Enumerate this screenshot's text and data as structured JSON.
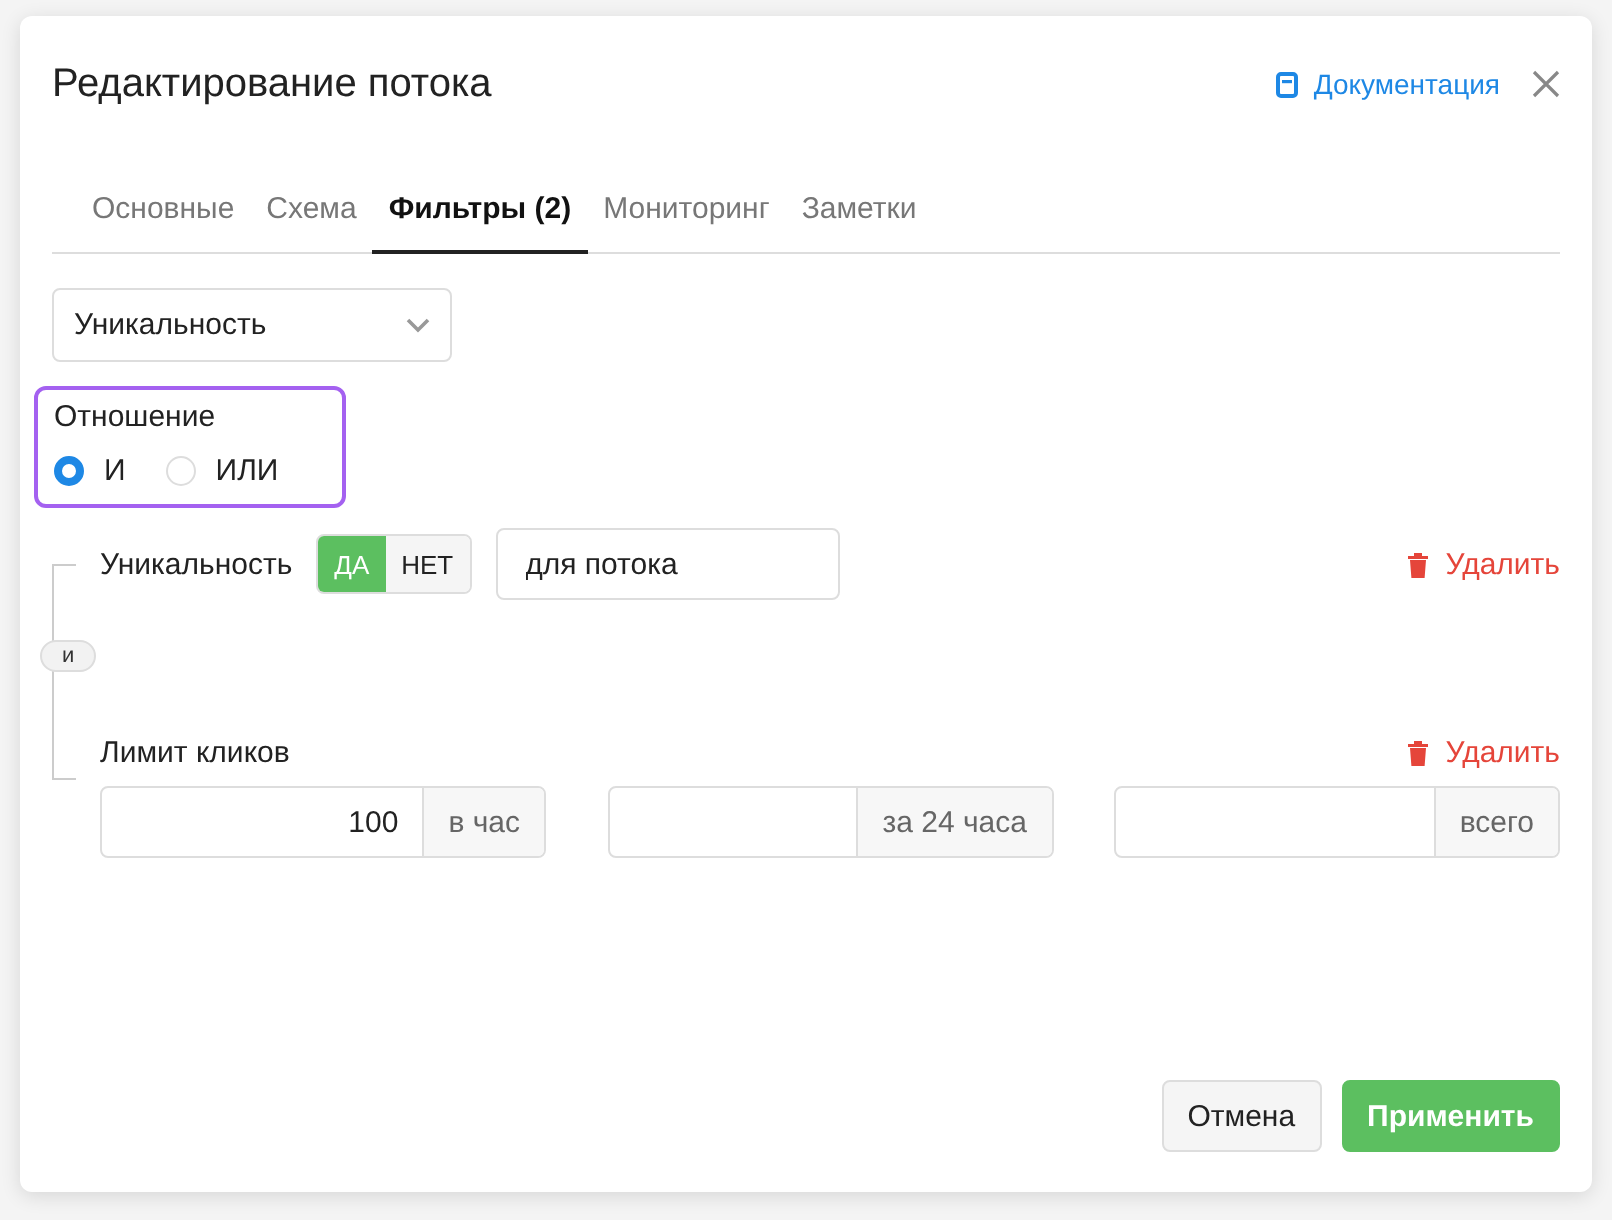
{
  "dialog": {
    "title": "Редактирование потока",
    "doc_link": "Документация"
  },
  "tabs": [
    {
      "label": "Основные",
      "selected": false
    },
    {
      "label": "Схема",
      "selected": false
    },
    {
      "label": "Фильтры (2)",
      "selected": true
    },
    {
      "label": "Мониторинг",
      "selected": false
    },
    {
      "label": "Заметки",
      "selected": false
    }
  ],
  "filter_select": {
    "value": "Уникальность"
  },
  "relation": {
    "label": "Отношение",
    "options": [
      {
        "label": "И",
        "selected": true
      },
      {
        "label": "ИЛИ",
        "selected": false
      }
    ]
  },
  "connector_label": "и",
  "filters": [
    {
      "kind": "toggle",
      "label": "Уникальность",
      "options": [
        {
          "label": "ДА",
          "selected": true
        },
        {
          "label": "НЕТ",
          "selected": false
        }
      ],
      "field_value": "для потока",
      "delete": "Удалить"
    },
    {
      "kind": "limits",
      "label": "Лимит кликов",
      "delete": "Удалить",
      "fields": [
        {
          "value": "100",
          "addon": "в час"
        },
        {
          "addon": "за 24 часа"
        },
        {
          "addon": "всего"
        }
      ]
    }
  ],
  "buttons": [
    {
      "label": "Отмена",
      "kind": "secondary"
    },
    {
      "label": "Применить",
      "kind": "primary"
    }
  ]
}
